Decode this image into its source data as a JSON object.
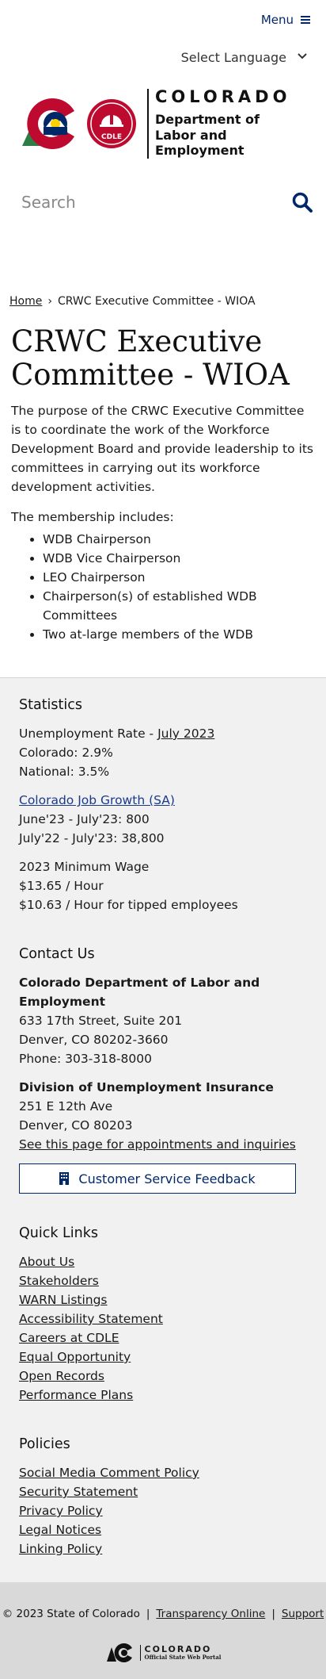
{
  "header": {
    "menu_label": "Menu",
    "language_label": "Select Language",
    "logo": {
      "state_name": "COLORADO",
      "dept_line1": "Department of",
      "dept_line2": "Labor and Employment",
      "badge_text": "CDLE"
    },
    "search_placeholder": "Search"
  },
  "breadcrumb": {
    "home": "Home",
    "separator": "›",
    "current": "CRWC Executive Committee - WIOA"
  },
  "main": {
    "title": "CRWC Executive Committee - WIOA",
    "intro": "The purpose of the CRWC Executive Committee is to coordinate the work of the Workforce Development Board and provide leadership to its committees in carrying out its workforce development activities.",
    "members_label": "The membership includes:",
    "members": [
      "WDB Chairperson",
      "WDB Vice Chairperson",
      "LEO Chairperson",
      "Chairperson(s) of established WDB Committees",
      "Two at-large members of the WDB"
    ]
  },
  "footer": {
    "statistics": {
      "heading": "Statistics",
      "unemployment_prefix": "Unemployment Rate - ",
      "unemployment_link": "July 2023",
      "colorado_rate": "Colorado: 2.9%",
      "national_rate": "National: 3.5%",
      "job_growth_link": "Colorado Job Growth (SA)",
      "job_growth_month": "June'23 - July'23: 800",
      "job_growth_year": "July'22 - July'23: 38,800",
      "min_wage_label": "2023 Minimum Wage",
      "min_wage_hourly": "$13.65 / Hour",
      "min_wage_tipped": "$10.63 / Hour for tipped employees"
    },
    "contact": {
      "heading": "Contact Us",
      "org_name": "Colorado Department of Labor and Employment",
      "org_street": "633 17th Street, Suite 201",
      "org_city": "Denver, CO  80202-3660",
      "org_phone": "Phone: 303-318-8000",
      "ui_name": "Division of Unemployment Insurance",
      "ui_street": "251 E 12th Ave",
      "ui_city": "Denver, CO  80203",
      "appointments_link": "See this page for appointments and inquiries",
      "feedback_button": "Customer Service Feedback"
    },
    "quick_links": {
      "heading": "Quick Links",
      "items": [
        "About Us",
        "Stakeholders",
        "WARN Listings",
        "Accessibility Statement",
        "Careers at CDLE",
        "Equal Opportunity",
        "Open Records",
        "Performance Plans"
      ]
    },
    "policies": {
      "heading": "Policies",
      "items": [
        "Social Media Comment Policy",
        "Security Statement",
        "Privacy Policy",
        "Legal Notices",
        "Linking Policy"
      ]
    }
  },
  "bottom": {
    "copyright": "© 2023 State of Colorado",
    "divider": "|",
    "transparency_link": "Transparency Online",
    "support_link": "Support",
    "portal_state": "COLORADO",
    "portal_sub": "Official State Web Portal"
  },
  "colors": {
    "brand_blue": "#002868",
    "brand_red": "#bf0a30",
    "brand_gold": "#ffd100",
    "tree_green": "#1f6b3a",
    "footer_bg": "#f1f1f1",
    "bottom_bar_bg": "#d9d9d9"
  },
  "icons": {
    "menu": "hamburger-icon",
    "language": "chevron-down-icon",
    "search": "search-icon",
    "feedback": "building-icon"
  }
}
